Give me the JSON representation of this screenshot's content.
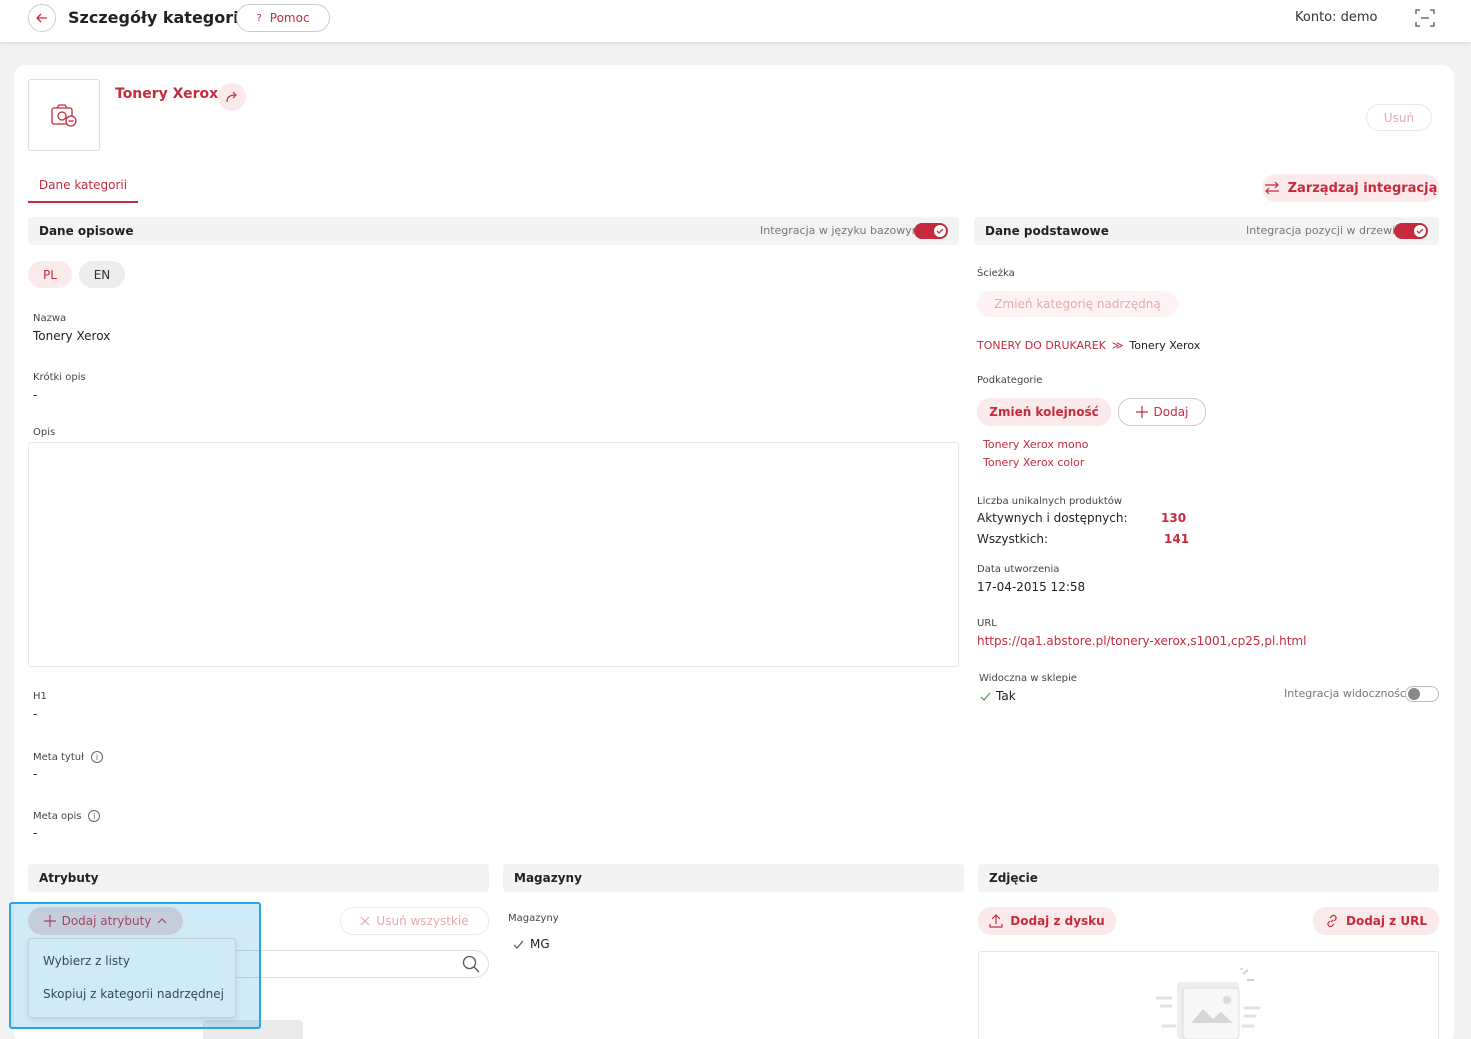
{
  "header": {
    "title": "Szczegóły kategorii",
    "help_label": "Pomoc",
    "help_glyph": "?",
    "account_text": "Konto: demo"
  },
  "category": {
    "name": "Tonery Xerox",
    "delete_label": "Usuń"
  },
  "tabs": [
    {
      "label": "Dane kategorii"
    }
  ],
  "integration_button": "Zarządzaj integracją",
  "descriptive": {
    "title": "Dane opisowe",
    "toggle_label": "Integracja w języku bazowym",
    "langs": [
      "PL",
      "EN"
    ],
    "fields": {
      "name_label": "Nazwa",
      "name_value": "Tonery Xerox",
      "short_label": "Krótki opis",
      "short_value": "-",
      "desc_label": "Opis",
      "h1_label": "H1",
      "h1_value": "-",
      "meta_title_label": "Meta tytuł",
      "meta_title_value": "-",
      "meta_desc_label": "Meta opis",
      "meta_desc_value": "-",
      "info_glyph": "i"
    }
  },
  "basic": {
    "title": "Dane podstawowe",
    "toggle_label": "Integracja pozycji w drzewie",
    "path_label": "Ścieżka",
    "change_parent": "Zmień kategorię nadrzędną",
    "breadcrumb_parent": "TONERY DO DRUKAREK",
    "breadcrumb_sep": "≫",
    "breadcrumb_current": "Tonery Xerox",
    "subcats_label": "Podkategorie",
    "change_order": "Zmień kolejność",
    "add_label": "Dodaj",
    "subcats": [
      "Tonery Xerox mono",
      "Tonery Xerox color"
    ],
    "products_label": "Liczba unikalnych produktów",
    "active_label": "Aktywnych i dostępnych:",
    "active_value": "130",
    "all_label": "Wszystkich:",
    "all_value": "141",
    "created_label": "Data utworzenia",
    "created_value": "17-04-2015 12:58",
    "url_label": "URL",
    "url_value": "https://qa1.abstore.pl/tonery-xerox,s1001,cp25,pl.html",
    "visible_label": "Widoczna w sklepie",
    "visible_value": "Tak",
    "visibility_toggle_label": "Integracja widoczności"
  },
  "attributes": {
    "title": "Atrybuty",
    "add_label": "Dodaj atrybuty",
    "remove_all": "Usuń wszystkie",
    "menu": [
      "Wybierz z listy",
      "Skopiuj z kategorii nadrzędnej"
    ]
  },
  "warehouses": {
    "title": "Magazyny",
    "label": "Magazyny",
    "items": [
      "MG"
    ]
  },
  "photo": {
    "title": "Zdjęcie",
    "from_disk": "Dodaj z dysku",
    "from_url": "Dodaj z URL"
  },
  "colors": {
    "accent": "#c52b3c",
    "accent_light": "#fbeaec",
    "highlight": "#29a6e0"
  }
}
